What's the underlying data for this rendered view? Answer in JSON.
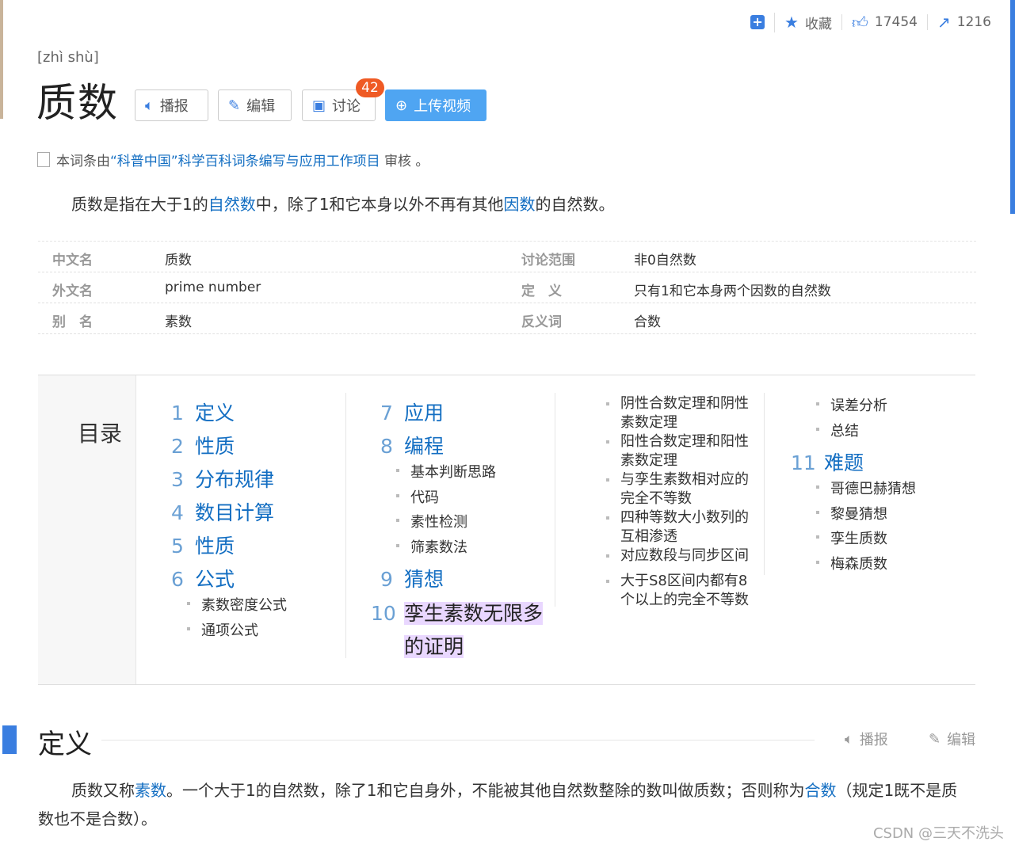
{
  "actions": {
    "collect_label": "收藏",
    "like_count": "17454",
    "share_count": "1216"
  },
  "pinyin": "[zhì shù]",
  "title": "质数",
  "buttons": {
    "broadcast": "播报",
    "edit": "编辑",
    "discuss": "讨论",
    "discuss_count": "42",
    "upload_video": "上传视频"
  },
  "review": {
    "prefix": "本词条由",
    "link": "“科普中国”科学百科词条编写与应用工作项目",
    "suffix": " 审核 。"
  },
  "lead": {
    "p1": "质数是指在大于1的",
    "link1": "自然数",
    "p2": "中，除了1和它本身以外不再有其他",
    "link2": "因数",
    "p3": "的自然数。"
  },
  "info": [
    {
      "k1": "中文名",
      "v1": "质数",
      "k2": "讨论范围",
      "v2": "非0自然数"
    },
    {
      "k1": "外文名",
      "v1": "prime number",
      "k2": "定　义",
      "v2": "只有1和它本身两个因数的自然数"
    },
    {
      "k1": "别　名",
      "v1": "素数",
      "k2": "反义词",
      "v2": "合数"
    }
  ],
  "catalog": {
    "title": "目录",
    "col1": [
      {
        "num": "1",
        "label": "定义"
      },
      {
        "num": "2",
        "label": "性质"
      },
      {
        "num": "3",
        "label": "分布规律"
      },
      {
        "num": "4",
        "label": "数目计算"
      },
      {
        "num": "5",
        "label": "性质"
      },
      {
        "num": "6",
        "label": "公式"
      }
    ],
    "col1_sub": [
      "素数密度公式",
      "通项公式"
    ],
    "col2": [
      {
        "num": "7",
        "label": "应用"
      },
      {
        "num": "8",
        "label": "编程"
      }
    ],
    "col2_sub": [
      "基本判断思路",
      "代码",
      "素性检测",
      "筛素数法"
    ],
    "col2b": [
      {
        "num": "9",
        "label": "猜想"
      },
      {
        "num": "10",
        "label": "孪生素数无限多",
        "label2": "的证明"
      }
    ],
    "col3_sub": [
      {
        "l1": "阴性合数定理和阴性",
        "l2": "素数定理"
      },
      {
        "l1": "阳性合数定理和阳性",
        "l2": "素数定理"
      },
      {
        "l1": "与孪生素数相对应的",
        "l2": "完全不等数"
      },
      {
        "l1": "四种等数大小数列的",
        "l2": "互相渗透"
      },
      {
        "l1": "对应数段与同步区间",
        "l2": ""
      },
      {
        "l1": "大于S8区间内都有8",
        "l2": "个以上的完全不等数"
      }
    ],
    "col4_sub_top": [
      "误差分析",
      "总结"
    ],
    "col4": {
      "num": "11",
      "label": "难题"
    },
    "col4_sub": [
      "哥德巴赫猜想",
      "黎曼猜想",
      "孪生质数",
      "梅森质数"
    ]
  },
  "section": {
    "title": "定义",
    "broadcast": "播报",
    "edit": "编辑",
    "p1": "质数又称",
    "link1": "素数",
    "p2": "。一个大于1的自然数，除了1和它自身外，不能被其他自然数整除的数叫做质数；否则称为",
    "link2": "合数",
    "p3": "（规定1既不是质数也不是合数）。"
  },
  "watermark": "CSDN @三天不洗头",
  "colors": {
    "accent": "#3a7ee0",
    "link": "#136ec2",
    "badge": "#ef5a24",
    "highlight": "#e9d7ff"
  }
}
